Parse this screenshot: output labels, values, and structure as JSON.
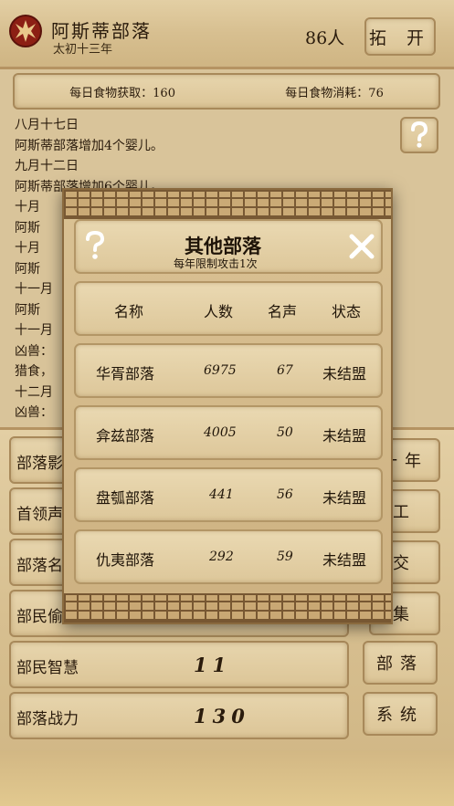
{
  "header": {
    "tribe_name": "阿斯蒂部落",
    "era": "太初十三年",
    "population": "86人",
    "expand_label": "拓 开"
  },
  "food": {
    "gain_label": "每日食物获取：",
    "gain_value": "160",
    "consume_label": "每日食物消耗：",
    "consume_value": "76"
  },
  "log": [
    "八月十七日",
    "阿斯蒂部落增加4个婴儿。",
    "九月十二日",
    "阿斯蒂部落增加6个婴儿。",
    "十月",
    "阿斯",
    "十月",
    "阿斯",
    "十一月",
    "阿斯",
    "十一月",
    "凶兽：",
    "猎食，",
    "十二月",
    "凶兽："
  ],
  "stats": [
    {
      "label": "部落影",
      "value": ""
    },
    {
      "label": "首领声",
      "value": ""
    },
    {
      "label": "部落名",
      "value": ""
    },
    {
      "label": "部民偷",
      "value": ""
    },
    {
      "label": "部民智慧",
      "value": "11"
    },
    {
      "label": "部落战力",
      "value": "130"
    }
  ],
  "side_buttons": [
    "一年",
    "工",
    "交",
    "集",
    "部落",
    "系统"
  ],
  "modal": {
    "title": "其他部落",
    "subtitle": "每年限制攻击1次",
    "columns": [
      "名称",
      "人数",
      "名声",
      "状态"
    ],
    "rows": [
      {
        "name": "华胥部落",
        "people": "6975",
        "fame": "67",
        "status": "未结盟"
      },
      {
        "name": "弇兹部落",
        "people": "4005",
        "fame": "50",
        "status": "未结盟"
      },
      {
        "name": "盘瓠部落",
        "people": "441",
        "fame": "56",
        "status": "未结盟"
      },
      {
        "name": "仇夷部落",
        "people": "292",
        "fame": "59",
        "status": "未结盟"
      }
    ]
  },
  "icons": {
    "logo": "horde-emblem-icon",
    "help": "question-icon",
    "close": "close-x-icon"
  },
  "colors": {
    "parchment": "#d9c49a",
    "border": "#a8895a",
    "emblem_red": "#8c1f14",
    "ink": "#2a1b0c"
  }
}
